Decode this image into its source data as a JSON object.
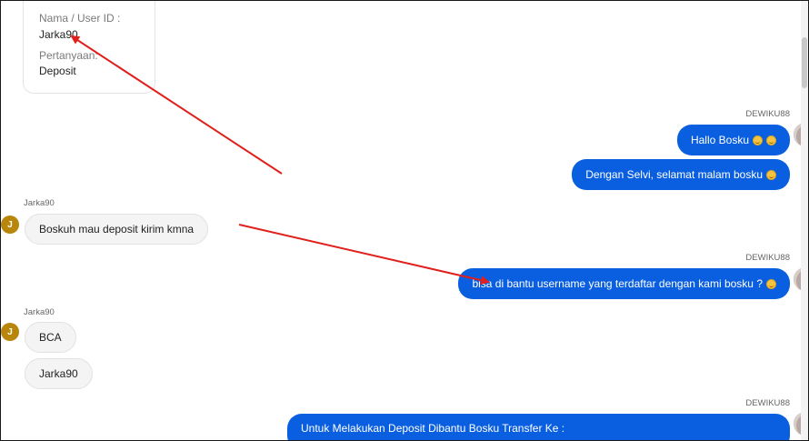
{
  "info_card": {
    "name_label": "Nama / User ID :",
    "name_value": "Jarka90",
    "question_label": "Pertanyaan:",
    "question_value": "Deposit"
  },
  "messages": [
    {
      "sender": "DEWIKU88",
      "direction": "outgoing",
      "bubbles": [
        "Hallo Bosku",
        "Dengan Selvi, selamat malam bosku"
      ]
    },
    {
      "sender": "Jarka90",
      "direction": "incoming",
      "avatar_letter": "J",
      "bubbles": [
        "Boskuh mau deposit kirim kmna"
      ]
    },
    {
      "sender": "DEWIKU88",
      "direction": "outgoing",
      "bubbles": [
        "bisa di bantu username yang terdaftar dengan kami bosku ?"
      ]
    },
    {
      "sender": "Jarka90",
      "direction": "incoming",
      "avatar_letter": "J",
      "bubbles": [
        "BCA",
        "Jarka90"
      ]
    },
    {
      "sender": "DEWIKU88",
      "direction": "outgoing",
      "bubbles": [
        "Untuk Melakukan Deposit Dibantu Bosku Transfer Ke :"
      ]
    }
  ],
  "colors": {
    "outgoing_bubble": "#0a5fe0",
    "incoming_bubble": "#f4f4f4",
    "annotation_arrow": "#e0201c",
    "avatar_incoming": "#b8860b"
  },
  "icons": [
    "heart-eyes-emoji",
    "smile-emoji",
    "user-avatar",
    "annotation-arrow"
  ]
}
